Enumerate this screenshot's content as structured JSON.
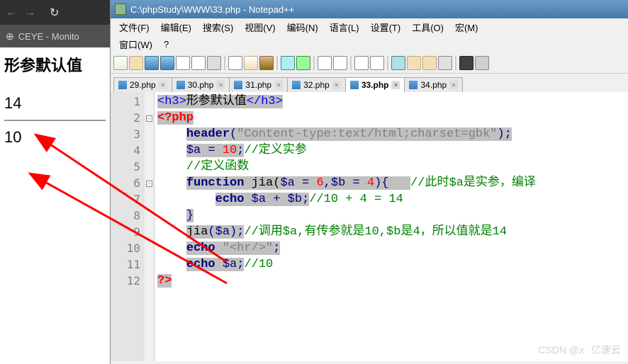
{
  "browser": {
    "tab_title": "CEYE - Monito",
    "heading": "形参默认值",
    "result1": "14",
    "result2": "10"
  },
  "notepad": {
    "title": "C:\\phpStudy\\WWW\\33.php - Notepad++",
    "menus": [
      "文件(F)",
      "编辑(E)",
      "搜索(S)",
      "视图(V)",
      "编码(N)",
      "语言(L)",
      "设置(T)",
      "工具(O)",
      "宏(M)"
    ],
    "menus2": [
      "窗口(W)",
      "?"
    ],
    "tabs": [
      {
        "label": "29.php",
        "active": false
      },
      {
        "label": "30.php",
        "active": false
      },
      {
        "label": "31.php",
        "active": false
      },
      {
        "label": "32.php",
        "active": false
      },
      {
        "label": "33.php",
        "active": true
      },
      {
        "label": "34.php",
        "active": false
      }
    ],
    "line_numbers": [
      "1",
      "2",
      "3",
      "4",
      "5",
      "6",
      "7",
      "8",
      "9",
      "10",
      "11",
      "12"
    ],
    "code": {
      "l1_tag_open": "<h3>",
      "l1_text": "形参默认值",
      "l1_tag_close": "</h3>",
      "l2": "<?php",
      "l3_kw": "header",
      "l3_paren_open": "(",
      "l3_str": "\"Content-type:text/html;charset=gbk\"",
      "l3_paren_close": ");",
      "l4_var": "$a",
      "l4_eq": " = ",
      "l4_num": "10",
      "l4_semi": ";",
      "l4_com": "//定义实参",
      "l5_com": "//定义函数",
      "l6_kw": "function",
      "l6_name": " jia(",
      "l6_var1": "$a",
      "l6_eq1": " = ",
      "l6_num1": "6",
      "l6_comma": ",",
      "l6_var2": "$b",
      "l6_eq2": " = ",
      "l6_num2": "4",
      "l6_close": "){   ",
      "l6_com": "//此时$a是实参，编译",
      "l7_kw": "echo",
      "l7_var1": " $a",
      "l7_op": " + ",
      "l7_var2": "$b",
      "l7_semi": ";",
      "l7_com": "//10 + 4 = 14",
      "l8": "}",
      "l9_func": "jia",
      "l9_paren": "(",
      "l9_var": "$a",
      "l9_close": ");",
      "l9_com": "//调用$a,有传参就是10,$b是4，所以值就是14",
      "l10_kw": "echo",
      "l10_str": " \"<hr/>\"",
      "l10_semi": ";",
      "l11_kw": "echo",
      "l11_var": " $a",
      "l11_semi": ";",
      "l11_com": "//10",
      "l12": "?>"
    }
  },
  "watermark": {
    "text": "CSDN @x",
    "logo_text": "亿速云"
  }
}
